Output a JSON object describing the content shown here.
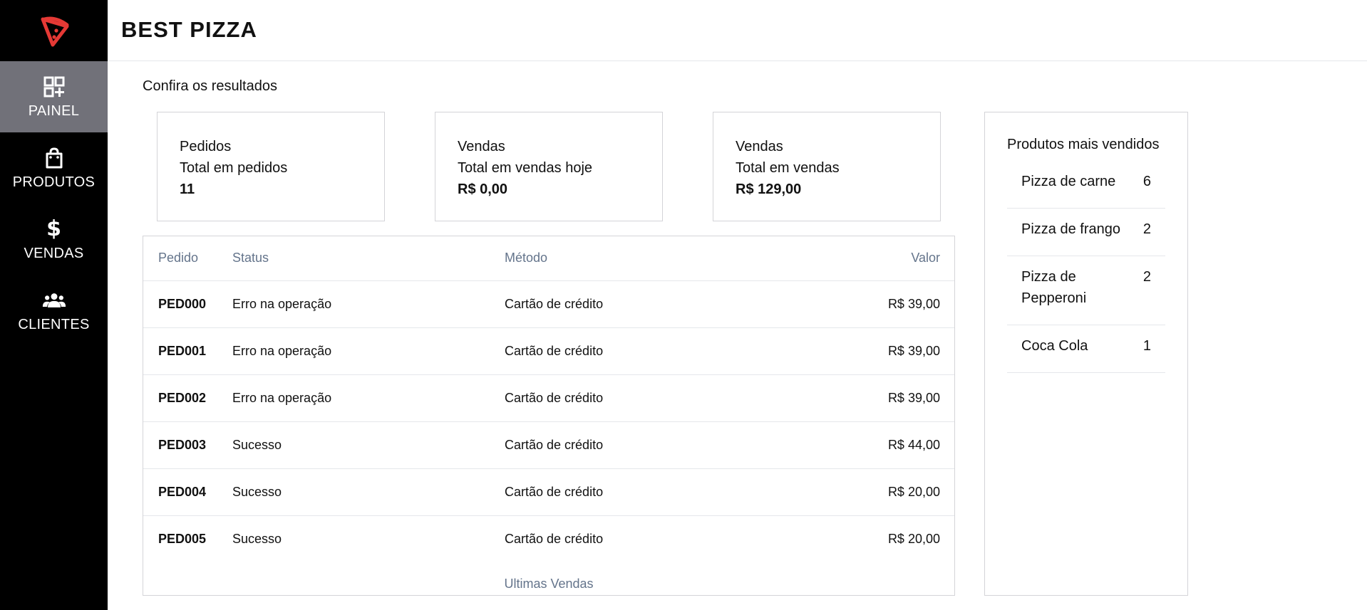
{
  "app": {
    "title": "BEST PIZZA"
  },
  "colors": {
    "logo": "#e53935",
    "sidebar_bg": "#000000",
    "sidebar_active": "#717179",
    "muted_text": "#64748b"
  },
  "nav": [
    {
      "label": "PAINEL",
      "icon": "dashboard-icon",
      "active": true
    },
    {
      "label": "PRODUTOS",
      "icon": "shopping-bag-icon",
      "active": false
    },
    {
      "label": "VENDAS",
      "icon": "dollar-icon",
      "active": false
    },
    {
      "label": "CLIENTES",
      "icon": "users-icon",
      "active": false
    }
  ],
  "page": {
    "subtitle": "Confira os resultados"
  },
  "cards": [
    {
      "title": "Pedidos",
      "subtitle": "Total em pedidos",
      "value": "11"
    },
    {
      "title": "Vendas",
      "subtitle": "Total em vendas hoje",
      "value": "R$ 0,00"
    },
    {
      "title": "Vendas",
      "subtitle": "Total em vendas",
      "value": "R$ 129,00"
    }
  ],
  "orders": {
    "headers": {
      "id": "Pedido",
      "status": "Status",
      "method": "Método",
      "value": "Valor"
    },
    "rows": [
      {
        "id": "PED000",
        "status": "Erro na operação",
        "method": "Cartão de crédito",
        "value": "R$ 39,00"
      },
      {
        "id": "PED001",
        "status": "Erro na operação",
        "method": "Cartão de crédito",
        "value": "R$ 39,00"
      },
      {
        "id": "PED002",
        "status": "Erro na operação",
        "method": "Cartão de crédito",
        "value": "R$ 39,00"
      },
      {
        "id": "PED003",
        "status": "Sucesso",
        "method": "Cartão de crédito",
        "value": "R$ 44,00"
      },
      {
        "id": "PED004",
        "status": "Sucesso",
        "method": "Cartão de crédito",
        "value": "R$ 20,00"
      },
      {
        "id": "PED005",
        "status": "Sucesso",
        "method": "Cartão de crédito",
        "value": "R$ 20,00"
      }
    ],
    "caption": "Ultimas Vendas"
  },
  "top_products": {
    "title": "Produtos mais vendidos",
    "items": [
      {
        "name": "Pizza de carne",
        "qty": "6"
      },
      {
        "name": "Pizza de frango",
        "qty": "2"
      },
      {
        "name": "Pizza de Pepperoni",
        "qty": "2"
      },
      {
        "name": "Coca Cola",
        "qty": "1"
      }
    ]
  }
}
